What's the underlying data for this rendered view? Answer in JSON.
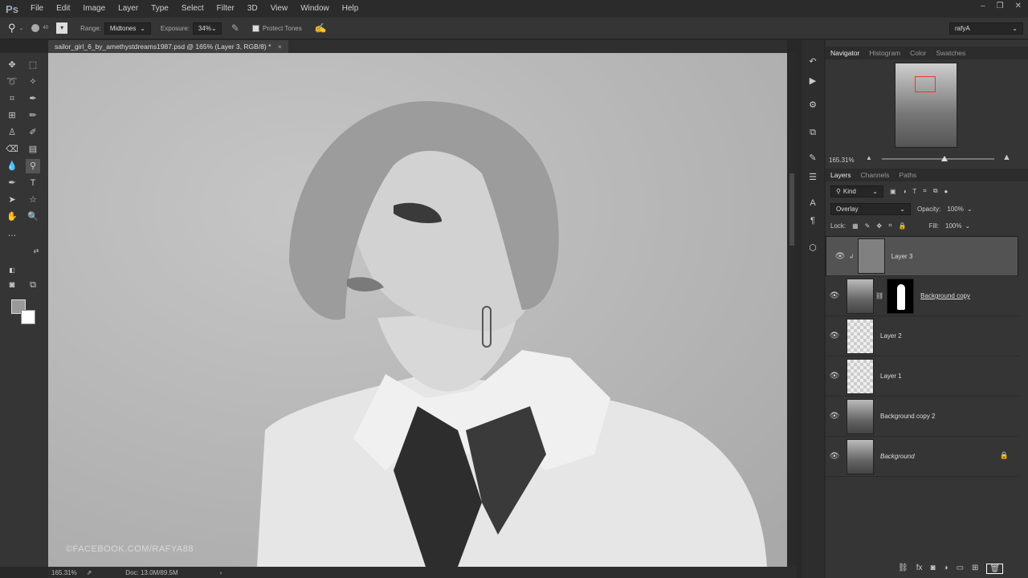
{
  "app": {
    "logo": "Ps"
  },
  "menu": [
    "File",
    "Edit",
    "Image",
    "Layer",
    "Type",
    "Select",
    "Filter",
    "3D",
    "View",
    "Window",
    "Help"
  ],
  "window_controls": [
    "–",
    "❐",
    "✕"
  ],
  "options_bar": {
    "brush_size": "40",
    "range_label": "Range:",
    "range_value": "Midtones",
    "exposure_label": "Exposure:",
    "exposure_value": "34%",
    "protect_tones_label": "Protect Tones",
    "workspace": "rafyA"
  },
  "document_tab": {
    "title": "sailor_girl_6_by_amethystdreams1987.psd @ 165% (Layer 3, RGB/8) *",
    "close": "×"
  },
  "watermark": "©FACEBOOK.COM/RAFYA88",
  "status": {
    "zoom": "165.31%",
    "doc": "Doc: 13.0M/89.5M"
  },
  "navigator": {
    "tabs": [
      "Navigator",
      "Histogram",
      "Color",
      "Swatches"
    ],
    "zoom": "165.31%"
  },
  "layers_panel": {
    "tabs": [
      "Layers",
      "Channels",
      "Paths"
    ],
    "filter_kind": "Kind",
    "blend_mode": "Overlay",
    "opacity_label": "Opacity:",
    "opacity": "100%",
    "lock_label": "Lock:",
    "fill_label": "Fill:",
    "fill": "100%",
    "layers": [
      {
        "name": "Layer 3",
        "thumb": "gray",
        "selected": true
      },
      {
        "name": "Background copy",
        "thumb": "photo",
        "mask": true
      },
      {
        "name": "Layer 2",
        "thumb": "checker"
      },
      {
        "name": "Layer 1",
        "thumb": "checker"
      },
      {
        "name": "Background copy 2",
        "thumb": "photo"
      },
      {
        "name": "Background",
        "thumb": "photo",
        "locked": true
      }
    ]
  }
}
